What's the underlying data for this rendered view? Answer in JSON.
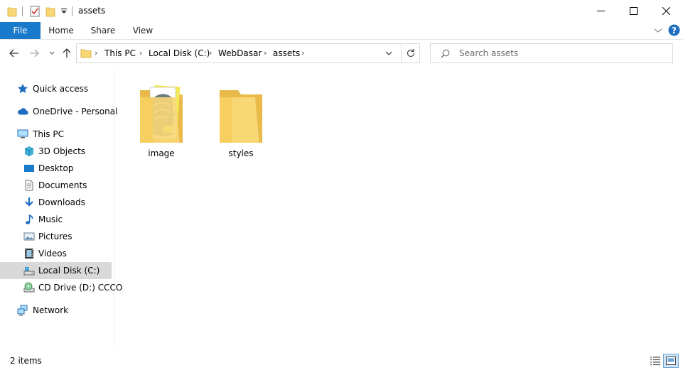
{
  "window": {
    "title": "assets"
  },
  "ribbon": {
    "tabs": [
      "File",
      "Home",
      "Share",
      "View"
    ]
  },
  "address": {
    "crumbs": [
      "This PC",
      "Local Disk (C:)",
      "WebDasar",
      "assets"
    ]
  },
  "search": {
    "placeholder": "Search assets"
  },
  "nav": {
    "items": [
      {
        "label": "Quick access",
        "icon": "star-icon"
      },
      {
        "label": "OneDrive - Personal",
        "icon": "cloud-icon"
      },
      {
        "label": "This PC",
        "icon": "computer-icon"
      },
      {
        "label": "3D Objects",
        "icon": "cube-icon"
      },
      {
        "label": "Desktop",
        "icon": "desktop-icon"
      },
      {
        "label": "Documents",
        "icon": "document-icon"
      },
      {
        "label": "Downloads",
        "icon": "download-icon"
      },
      {
        "label": "Music",
        "icon": "music-icon"
      },
      {
        "label": "Pictures",
        "icon": "pictures-icon"
      },
      {
        "label": "Videos",
        "icon": "video-icon"
      },
      {
        "label": "Local Disk (C:)",
        "icon": "drive-icon"
      },
      {
        "label": "CD Drive (D:) CCCO",
        "icon": "cd-drive-icon"
      },
      {
        "label": "Network",
        "icon": "network-icon"
      }
    ],
    "selected": "Local Disk (C:)"
  },
  "files": [
    {
      "name": "image",
      "icon": "folder-with-preview-icon"
    },
    {
      "name": "styles",
      "icon": "folder-icon"
    }
  ],
  "status": {
    "count": "2 items"
  },
  "colors": {
    "accent": "#1979ca",
    "folder": "#f8d775",
    "selected": "#d9d9d9",
    "help": "#1e6fc2"
  }
}
